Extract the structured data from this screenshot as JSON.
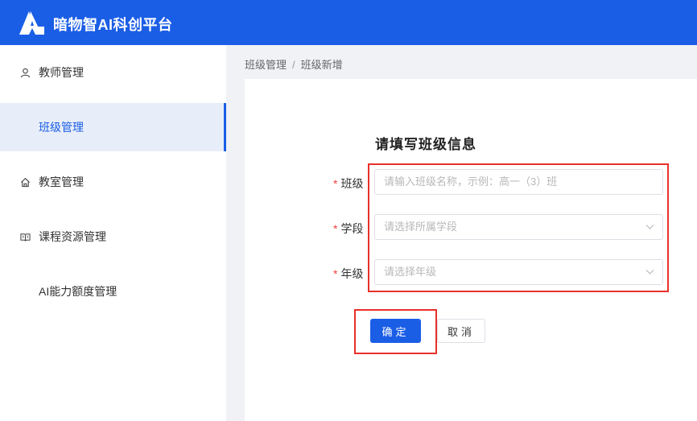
{
  "app": {
    "title": "暗物智AI科创平台"
  },
  "sidebar": {
    "items": [
      {
        "label": "教师管理",
        "icon": "user-icon"
      },
      {
        "label": "班级管理",
        "icon": "",
        "active": true
      },
      {
        "label": "教室管理",
        "icon": "home-icon"
      },
      {
        "label": "课程资源管理",
        "icon": "book-icon"
      },
      {
        "label": "AI能力额度管理",
        "icon": ""
      }
    ]
  },
  "breadcrumb": {
    "parent": "班级管理",
    "separator": "/",
    "current": "班级新增"
  },
  "form": {
    "title": "请填写班级信息",
    "required_mark": "*",
    "fields": [
      {
        "label": "班级",
        "placeholder": "请输入班级名称，示例：高一（3）班"
      },
      {
        "label": "学段",
        "placeholder": "请选择所属学段"
      },
      {
        "label": "年级",
        "placeholder": "请选择年级"
      }
    ],
    "submit_label": "确定",
    "cancel_label": "取消"
  },
  "colors": {
    "brand": "#1b5ee6",
    "highlight": "#e8302a",
    "required": "#f0403d"
  }
}
